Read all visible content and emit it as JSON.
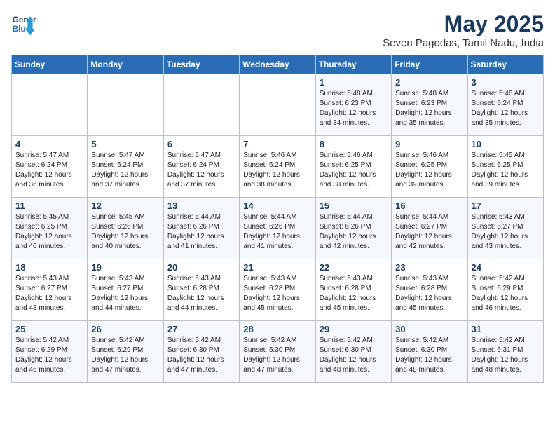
{
  "logo": {
    "line1": "General",
    "line2": "Blue"
  },
  "title": "May 2025",
  "location": "Seven Pagodas, Tamil Nadu, India",
  "days_of_week": [
    "Sunday",
    "Monday",
    "Tuesday",
    "Wednesday",
    "Thursday",
    "Friday",
    "Saturday"
  ],
  "weeks": [
    [
      {
        "day": "",
        "text": ""
      },
      {
        "day": "",
        "text": ""
      },
      {
        "day": "",
        "text": ""
      },
      {
        "day": "",
        "text": ""
      },
      {
        "day": "1",
        "text": "Sunrise: 5:48 AM\nSunset: 6:23 PM\nDaylight: 12 hours\nand 34 minutes."
      },
      {
        "day": "2",
        "text": "Sunrise: 5:48 AM\nSunset: 6:23 PM\nDaylight: 12 hours\nand 35 minutes."
      },
      {
        "day": "3",
        "text": "Sunrise: 5:48 AM\nSunset: 6:24 PM\nDaylight: 12 hours\nand 35 minutes."
      }
    ],
    [
      {
        "day": "4",
        "text": "Sunrise: 5:47 AM\nSunset: 6:24 PM\nDaylight: 12 hours\nand 36 minutes."
      },
      {
        "day": "5",
        "text": "Sunrise: 5:47 AM\nSunset: 6:24 PM\nDaylight: 12 hours\nand 37 minutes."
      },
      {
        "day": "6",
        "text": "Sunrise: 5:47 AM\nSunset: 6:24 PM\nDaylight: 12 hours\nand 37 minutes."
      },
      {
        "day": "7",
        "text": "Sunrise: 5:46 AM\nSunset: 6:24 PM\nDaylight: 12 hours\nand 38 minutes."
      },
      {
        "day": "8",
        "text": "Sunrise: 5:46 AM\nSunset: 6:25 PM\nDaylight: 12 hours\nand 38 minutes."
      },
      {
        "day": "9",
        "text": "Sunrise: 5:46 AM\nSunset: 6:25 PM\nDaylight: 12 hours\nand 39 minutes."
      },
      {
        "day": "10",
        "text": "Sunrise: 5:45 AM\nSunset: 6:25 PM\nDaylight: 12 hours\nand 39 minutes."
      }
    ],
    [
      {
        "day": "11",
        "text": "Sunrise: 5:45 AM\nSunset: 6:25 PM\nDaylight: 12 hours\nand 40 minutes."
      },
      {
        "day": "12",
        "text": "Sunrise: 5:45 AM\nSunset: 6:26 PM\nDaylight: 12 hours\nand 40 minutes."
      },
      {
        "day": "13",
        "text": "Sunrise: 5:44 AM\nSunset: 6:26 PM\nDaylight: 12 hours\nand 41 minutes."
      },
      {
        "day": "14",
        "text": "Sunrise: 5:44 AM\nSunset: 6:26 PM\nDaylight: 12 hours\nand 41 minutes."
      },
      {
        "day": "15",
        "text": "Sunrise: 5:44 AM\nSunset: 6:26 PM\nDaylight: 12 hours\nand 42 minutes."
      },
      {
        "day": "16",
        "text": "Sunrise: 5:44 AM\nSunset: 6:27 PM\nDaylight: 12 hours\nand 42 minutes."
      },
      {
        "day": "17",
        "text": "Sunrise: 5:43 AM\nSunset: 6:27 PM\nDaylight: 12 hours\nand 43 minutes."
      }
    ],
    [
      {
        "day": "18",
        "text": "Sunrise: 5:43 AM\nSunset: 6:27 PM\nDaylight: 12 hours\nand 43 minutes."
      },
      {
        "day": "19",
        "text": "Sunrise: 5:43 AM\nSunset: 6:27 PM\nDaylight: 12 hours\nand 44 minutes."
      },
      {
        "day": "20",
        "text": "Sunrise: 5:43 AM\nSunset: 6:28 PM\nDaylight: 12 hours\nand 44 minutes."
      },
      {
        "day": "21",
        "text": "Sunrise: 5:43 AM\nSunset: 6:28 PM\nDaylight: 12 hours\nand 45 minutes."
      },
      {
        "day": "22",
        "text": "Sunrise: 5:43 AM\nSunset: 6:28 PM\nDaylight: 12 hours\nand 45 minutes."
      },
      {
        "day": "23",
        "text": "Sunrise: 5:43 AM\nSunset: 6:28 PM\nDaylight: 12 hours\nand 45 minutes."
      },
      {
        "day": "24",
        "text": "Sunrise: 5:42 AM\nSunset: 6:29 PM\nDaylight: 12 hours\nand 46 minutes."
      }
    ],
    [
      {
        "day": "25",
        "text": "Sunrise: 5:42 AM\nSunset: 6:29 PM\nDaylight: 12 hours\nand 46 minutes."
      },
      {
        "day": "26",
        "text": "Sunrise: 5:42 AM\nSunset: 6:29 PM\nDaylight: 12 hours\nand 47 minutes."
      },
      {
        "day": "27",
        "text": "Sunrise: 5:42 AM\nSunset: 6:30 PM\nDaylight: 12 hours\nand 47 minutes."
      },
      {
        "day": "28",
        "text": "Sunrise: 5:42 AM\nSunset: 6:30 PM\nDaylight: 12 hours\nand 47 minutes."
      },
      {
        "day": "29",
        "text": "Sunrise: 5:42 AM\nSunset: 6:30 PM\nDaylight: 12 hours\nand 48 minutes."
      },
      {
        "day": "30",
        "text": "Sunrise: 5:42 AM\nSunset: 6:30 PM\nDaylight: 12 hours\nand 48 minutes."
      },
      {
        "day": "31",
        "text": "Sunrise: 5:42 AM\nSunset: 6:31 PM\nDaylight: 12 hours\nand 48 minutes."
      }
    ]
  ]
}
